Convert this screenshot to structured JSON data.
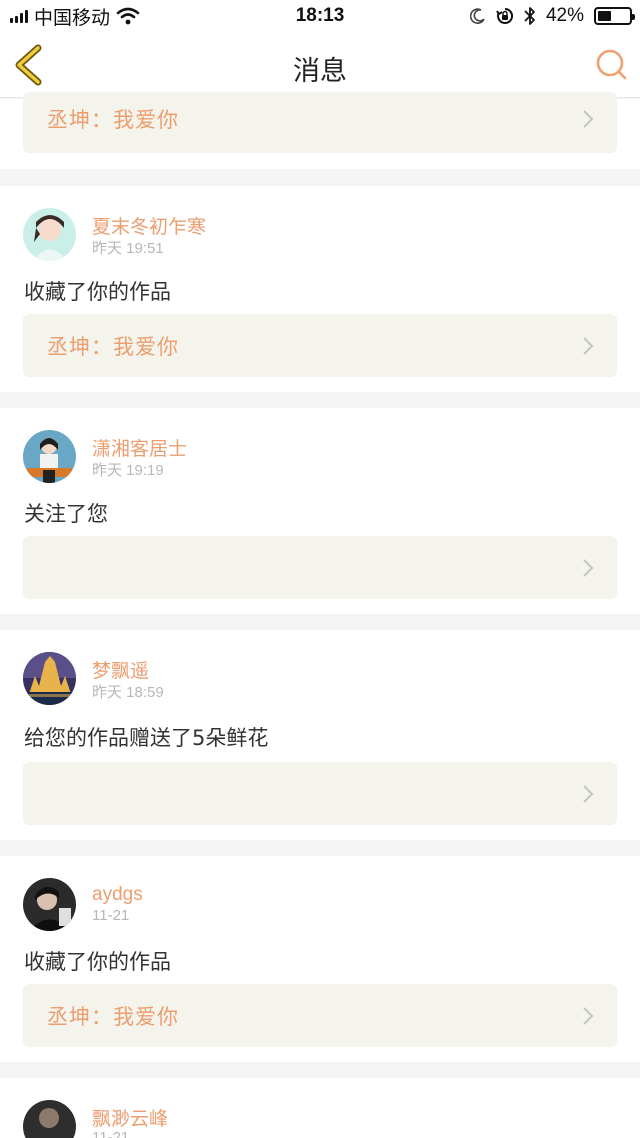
{
  "status_bar": {
    "carrier": "中国移动",
    "time": "18:13",
    "battery_percent": "42%",
    "battery_level": 0.42,
    "icons": [
      "signal-icon",
      "wifi-icon",
      "moon-icon",
      "orientation-lock-icon",
      "bluetooth-icon",
      "battery-icon"
    ]
  },
  "nav": {
    "title": "消息",
    "back_icon": "chevron-left-icon",
    "search_icon": "search-icon",
    "accent": "#f0a070"
  },
  "top_partial": {
    "quote": "丞坤：我爱你"
  },
  "messages": [
    {
      "user": "夏末冬初乍寒",
      "time": "昨天 19:51",
      "action": "收藏了你的作品",
      "quote": "丞坤：我爱你"
    },
    {
      "user": "潇湘客居士",
      "time": "昨天 19:19",
      "action": "关注了您",
      "quote": ""
    },
    {
      "user": "梦飘遥",
      "time": "昨天 18:59",
      "action": "给您的作品赠送了5朵鲜花",
      "quote": ""
    },
    {
      "user": "aydgs",
      "time": "11-21",
      "action": "收藏了你的作品",
      "quote": "丞坤：我爱你"
    },
    {
      "user": "飘渺云峰",
      "time": "11-21"
    }
  ],
  "colors": {
    "username": "#ec9e6f",
    "quote_bg": "#f4f4ec",
    "page_bg": "#f5f5f5",
    "time": "#b7b7b7"
  }
}
